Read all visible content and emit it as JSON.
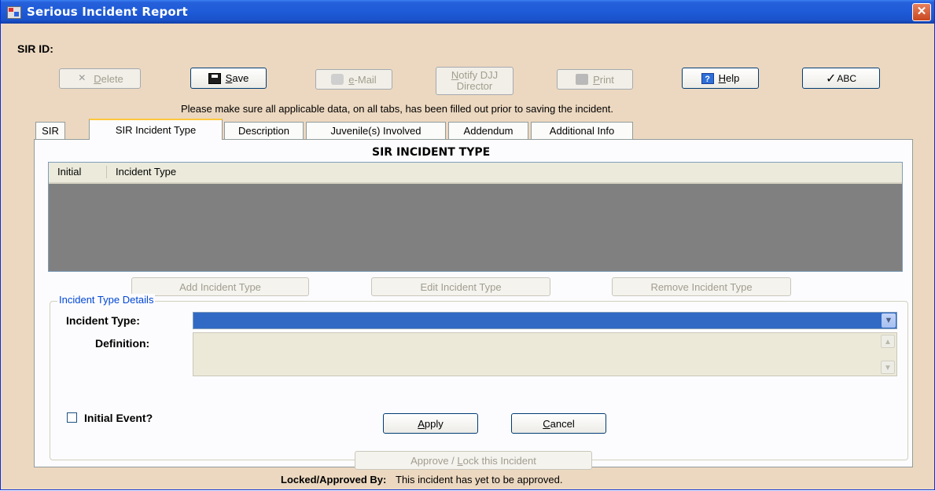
{
  "window": {
    "title": "Serious Incident Report",
    "close_glyph": "✕"
  },
  "sir_id": {
    "label": "SIR ID:"
  },
  "toolbar": {
    "delete": {
      "pre": "",
      "mnemonic": "D",
      "post": "elete",
      "icon": "delete-x-icon",
      "enabled": false
    },
    "save": {
      "pre": "",
      "mnemonic": "S",
      "post": "ave",
      "icon": "floppy-disk-icon",
      "enabled": true
    },
    "email": {
      "pre": "",
      "mnemonic": "e",
      "post": "-Mail",
      "icon": "envelope-icon",
      "enabled": false
    },
    "notify": {
      "line1_mnemonic": "N",
      "line1_rest": "otify DJJ",
      "line2": "Director",
      "enabled": false
    },
    "print": {
      "pre": "",
      "mnemonic": "P",
      "post": "rint",
      "icon": "printer-icon",
      "enabled": false
    },
    "help": {
      "pre": "",
      "mnemonic": "H",
      "post": "elp",
      "icon": "help-question-icon",
      "enabled": true
    },
    "spell": {
      "check": "✓",
      "label": "ABC",
      "icon": "spellcheck-icon",
      "enabled": true
    }
  },
  "notice": "Please make sure all applicable data, on all tabs, has been filled out prior to saving the incident.",
  "tabs": [
    {
      "label": "SIR",
      "active": false
    },
    {
      "label": "SIR Incident Type",
      "active": true
    },
    {
      "label": "Description",
      "active": false
    },
    {
      "label": "Juvenile(s) Involved",
      "active": false
    },
    {
      "label": "Addendum",
      "active": false
    },
    {
      "label": "Additional Info",
      "active": false
    }
  ],
  "section_title": "SIR INCIDENT TYPE",
  "grid": {
    "columns": [
      "Initial",
      "Incident Type"
    ],
    "rows": []
  },
  "grid_buttons": {
    "add": "Add Incident Type",
    "edit": "Edit Incident Type",
    "remove": "Remove Incident Type"
  },
  "details": {
    "legend": "Incident Type Details",
    "incident_type_label": "Incident Type:",
    "incident_type_value": "",
    "definition_label": "Definition:",
    "definition_value": "",
    "initial_event_label": "Initial Event?",
    "initial_event_checked": false,
    "apply": {
      "mnemonic": "A",
      "rest": "pply"
    },
    "cancel": {
      "mnemonic": "C",
      "rest": "ancel"
    }
  },
  "approve": {
    "pre": "Approve / ",
    "mnemonic": "L",
    "post": "ock this Incident"
  },
  "locked_by": {
    "label": "Locked/Approved By:",
    "value": "This incident has yet to be approved."
  },
  "colors": {
    "title_bar": "#1E5BD8",
    "window_bg": "#ECD8C0",
    "selection": "#316AC5",
    "grid_bg": "#808080",
    "legend": "#0046D5"
  }
}
